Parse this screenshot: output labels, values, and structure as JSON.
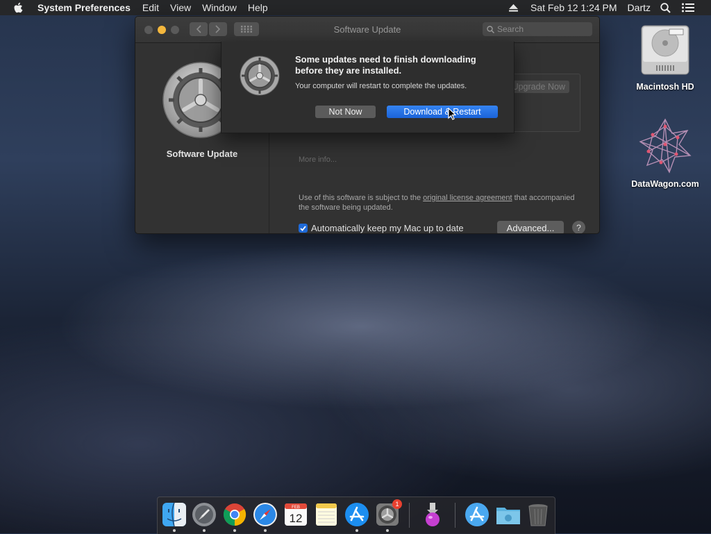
{
  "menubar": {
    "app_name": "System Preferences",
    "items": [
      "Edit",
      "View",
      "Window",
      "Help"
    ],
    "datetime": "Sat Feb 12  1:24 PM",
    "user": "Dartz"
  },
  "window": {
    "title": "Software Update",
    "search_placeholder": "Search",
    "sidebar_label": "Software Update",
    "upgrade_button": "Upgrade Now",
    "more_info": "More info...",
    "license_prefix": "Use of this software is subject to the ",
    "license_link": "original license agreement",
    "license_suffix": " that accompanied the software being updated.",
    "auto_update_label": "Automatically keep my Mac up to date",
    "auto_update_checked": true,
    "advanced_button": "Advanced...",
    "help_button": "?"
  },
  "dialog": {
    "title": "Some updates need to finish downloading before they are installed.",
    "message": "Your computer will restart to complete the updates.",
    "cancel_button": "Not Now",
    "confirm_button": "Download & Restart"
  },
  "desktop": {
    "icons": [
      {
        "label": "Macintosh HD",
        "icon": "hard-drive-icon"
      },
      {
        "label": "DataWagon.com",
        "icon": "datawagon-logo-icon"
      }
    ]
  },
  "dock": {
    "calendar_month": "FEB",
    "calendar_day": "12",
    "settings_badge": "1",
    "items": [
      "finder-icon",
      "launchpad-icon",
      "chrome-icon",
      "safari-icon",
      "calendar-icon",
      "notes-icon",
      "app-store-icon",
      "system-preferences-icon",
      "installer-icon",
      "applications-folder-icon",
      "downloads-folder-icon",
      "trash-icon"
    ]
  },
  "colors": {
    "accent": "#1b63d8",
    "minimize": "#f4b73d",
    "badge": "#e8402f"
  }
}
